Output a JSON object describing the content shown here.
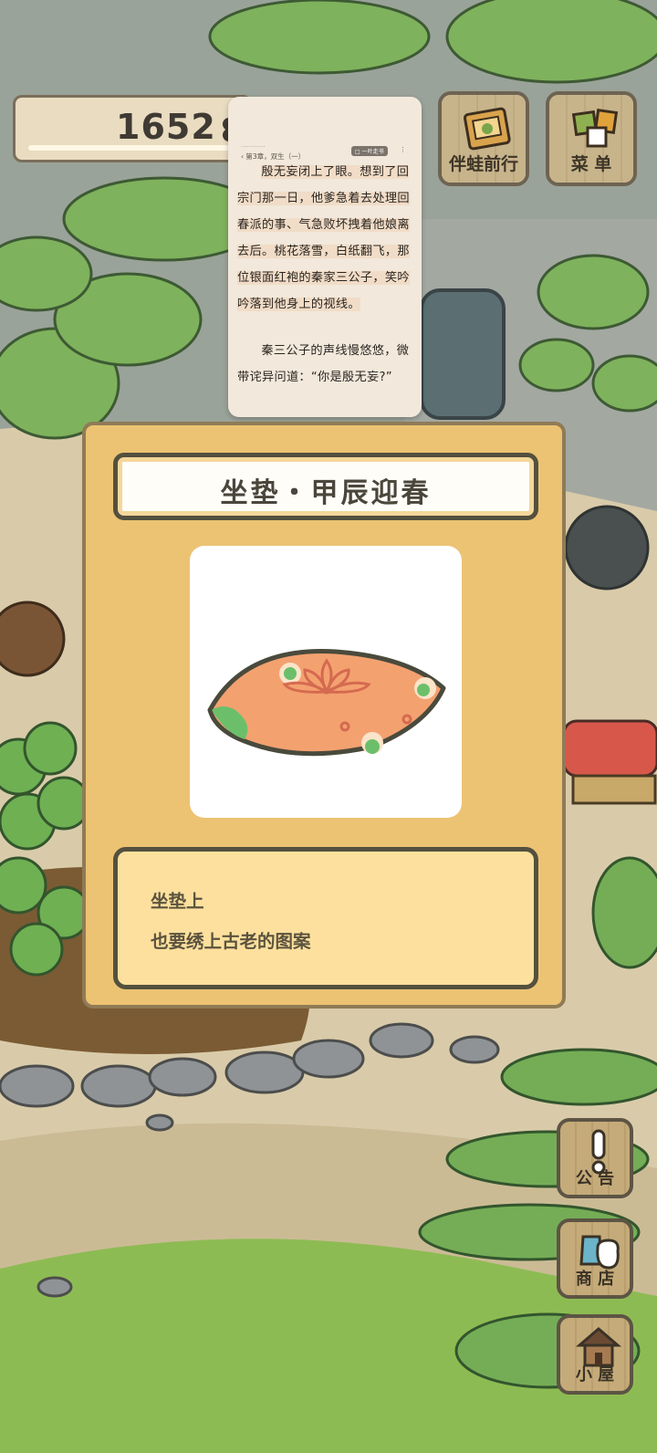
{
  "counter": {
    "value": "1652",
    "icon": "clover-icon"
  },
  "top_buttons": {
    "travel_label": "伴蛙前行",
    "menu_label": "菜 单"
  },
  "reader": {
    "meta": "············",
    "chapter": "‹ 第3章，双生（一）",
    "tag": "□ 一叶走书",
    "more": "⋮",
    "paragraph1": "殷无妄闭上了眼。想到了回宗门那一日，他爹急着去处理回春派的事、气急败坏拽着他娘离去后。桃花落雪，白纸翻飞，那位银面红袍的秦家三公子，笑吟吟落到他身上的视线。",
    "paragraph2": "秦三公子的声线慢悠悠，微带诧异问道：“你是殷无妄?”"
  },
  "modal": {
    "title": "坐垫・甲辰迎春",
    "description_line1": "坐垫上",
    "description_line2": "也要绣上古老的图案"
  },
  "side_buttons": {
    "notice_label": "公 告",
    "shop_label": "商 店",
    "house_label": "小 屋"
  },
  "colors": {
    "modal_bg": "#ecc373",
    "desc_bg": "#fde09d",
    "cushion": "#f4a170",
    "leaf": "#6fb053"
  }
}
